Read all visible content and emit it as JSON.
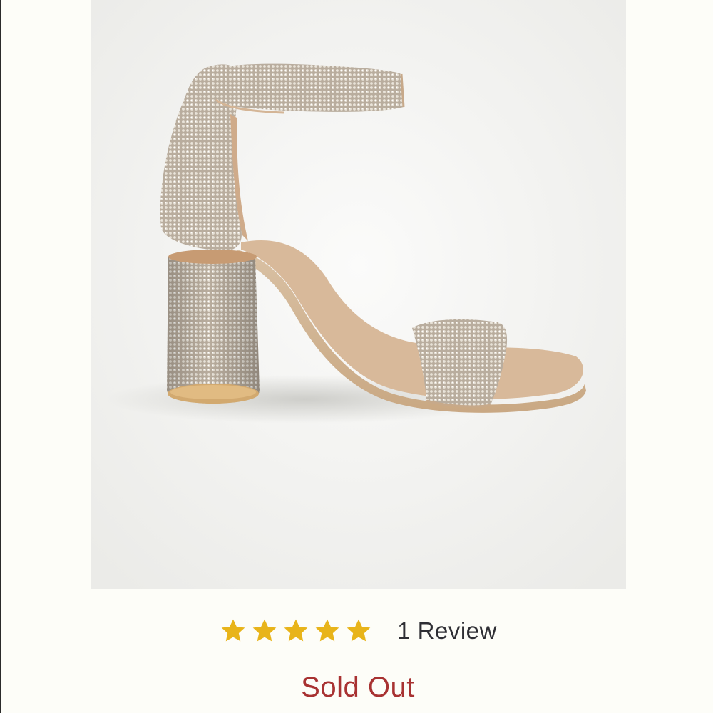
{
  "product": {
    "image_alt": "Rhinestone ankle strap block heel sandal",
    "rating": {
      "stars": 5,
      "max_stars": 5,
      "star_color": "#e8b41a",
      "review_label": "1 Review"
    },
    "status_label": "Sold Out",
    "status_color": "#a83232"
  }
}
